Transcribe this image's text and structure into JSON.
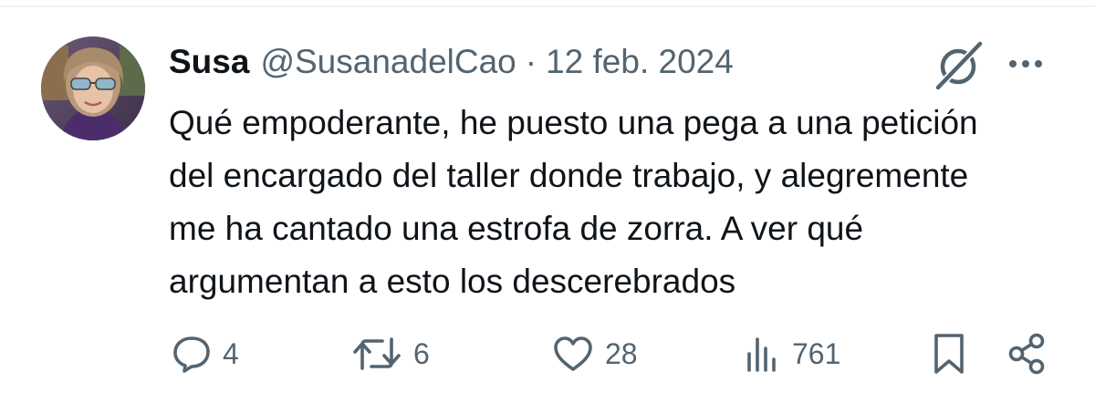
{
  "tweet": {
    "author": {
      "display_name": "Susa",
      "handle": "@SusanadelCao"
    },
    "separator": "·",
    "date": "12 feb. 2024",
    "text": "Qué empoderante, he puesto una pega a una petición del encargado del taller donde trabajo, y alegremente me ha cantado una estrofa de zorra. A ver qué argumentan a esto los descerebrados",
    "header_icons": [
      "grok-icon",
      "more-icon"
    ],
    "metrics": {
      "replies": "4",
      "retweets": "6",
      "likes": "28",
      "views": "761"
    },
    "action_icons": [
      "reply-icon",
      "retweet-icon",
      "like-icon",
      "views-icon",
      "bookmark-icon",
      "share-icon"
    ]
  },
  "colors": {
    "text_primary": "#0f1419",
    "text_secondary": "#536471",
    "divider": "#eff3f4",
    "background": "#ffffff"
  }
}
